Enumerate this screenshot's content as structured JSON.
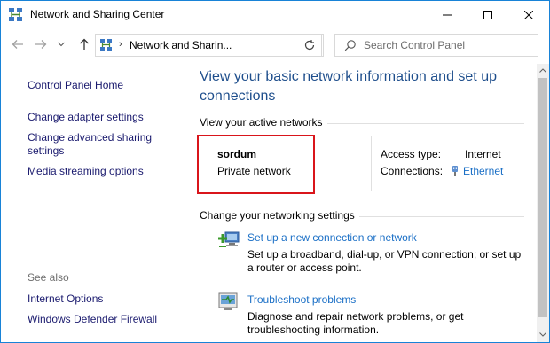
{
  "window": {
    "title": "Network and Sharing Center",
    "icon": "network-center-icon",
    "accent": "#1883d7"
  },
  "nav": {
    "back_icon": "arrow-left-icon",
    "forward_icon": "arrow-right-icon",
    "up_icon": "arrow-up-icon",
    "breadcrumb": "Network and Sharin...",
    "search_placeholder": "Search Control Panel"
  },
  "sidebar": {
    "home": "Control Panel Home",
    "items": [
      "Change adapter settings",
      "Change advanced sharing settings",
      "Media streaming options"
    ],
    "see_also_label": "See also",
    "see_also": [
      "Internet Options",
      "Windows Defender Firewall"
    ]
  },
  "main": {
    "title": "View your basic network information and set up connections",
    "active_label": "View your active networks",
    "network": {
      "name": "sordum",
      "type": "Private network",
      "access_label": "Access type:",
      "access_value": "Internet",
      "connections_label": "Connections:",
      "connections_value": "Ethernet"
    },
    "change_label": "Change your networking settings",
    "tasks": [
      {
        "link": "Set up a new connection or network",
        "desc": "Set up a broadband, dial-up, or VPN connection; or set up a router or access point.",
        "icon": "new-connection-icon"
      },
      {
        "link": "Troubleshoot problems",
        "desc": "Diagnose and repair network problems, or get troubleshooting information.",
        "icon": "troubleshoot-icon"
      }
    ]
  },
  "colors": {
    "link": "#1a6fc6",
    "nav_link": "#1a1a6e",
    "title": "#1e4e8c",
    "highlight": "#d9151b"
  }
}
